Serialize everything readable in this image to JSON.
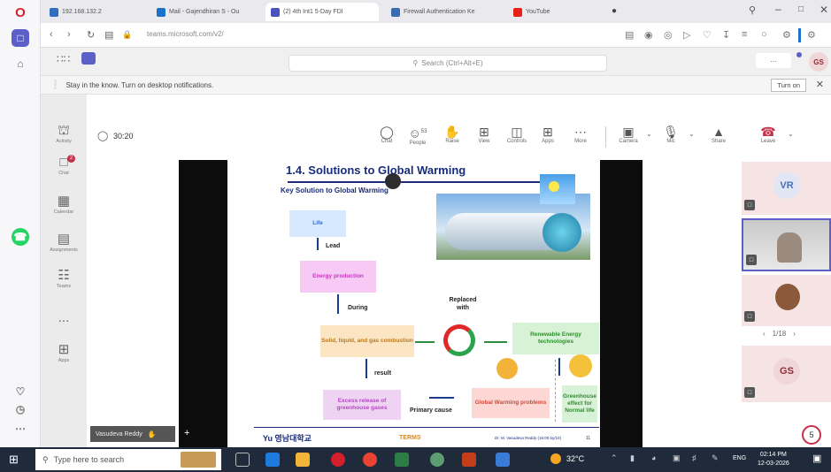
{
  "browser": {
    "tabs": [
      {
        "label": "192.168.132.2",
        "color": "#2f6fbf"
      },
      {
        "label": "Mail - Gajendhiran S - Ou",
        "color": "#1a73c9"
      },
      {
        "label": "(2) 4th Int1 5-Day FDI",
        "color": "#4b53bc"
      },
      {
        "label": "Firewall Authentication Ke",
        "color": "#3b6bb0"
      },
      {
        "label": "YouTube",
        "color": "#e62117"
      }
    ],
    "url": "teams.microsoft.com/v2/",
    "colors": {
      "opera_red": "#d4202b",
      "teams_purple": "#5b5fc7"
    }
  },
  "teams": {
    "search_placeholder": "Search (Ctrl+Alt+E)",
    "more_label": "...",
    "user_initials": "GS",
    "notification": {
      "text": "Stay in the know. Turn on desktop notifications.",
      "button": "Turn on"
    },
    "rail": [
      {
        "label": "Activity",
        "icon": "bell-icon"
      },
      {
        "label": "Chat",
        "icon": "chat-icon",
        "badge": "2"
      },
      {
        "label": "Calendar",
        "icon": "calendar-icon"
      },
      {
        "label": "Assignments",
        "icon": "assignments-icon"
      },
      {
        "label": "Teams",
        "icon": "teams-icon"
      },
      {
        "label": "...",
        "icon": "more-icon"
      },
      {
        "label": "Apps",
        "icon": "apps-icon"
      }
    ]
  },
  "meeting": {
    "timer": "30:20",
    "people_count": "53",
    "toolbar": [
      {
        "label": "Chat",
        "icon": "chat-icon"
      },
      {
        "label": "People",
        "icon": "people-icon"
      },
      {
        "label": "Raise",
        "icon": "raise-hand-icon"
      },
      {
        "label": "View",
        "icon": "view-icon"
      },
      {
        "label": "Controls",
        "icon": "controls-icon"
      },
      {
        "label": "Apps",
        "icon": "apps-icon"
      },
      {
        "label": "More",
        "icon": "more-icon"
      },
      {
        "label": "Camera",
        "icon": "camera-icon"
      },
      {
        "label": "Mic",
        "icon": "mic-icon"
      },
      {
        "label": "Share",
        "icon": "share-icon"
      },
      {
        "label": "Leave",
        "icon": "leave-icon"
      }
    ],
    "presenter": "Vasudeva Reddy",
    "participants": [
      {
        "initials": "VR",
        "color": "#4a6fb5"
      },
      {
        "initials": "",
        "type": "video"
      },
      {
        "initials": "",
        "type": "photo"
      },
      {
        "initials": "GS",
        "color": "#8a2e34"
      }
    ],
    "page_indicator": "1/18",
    "slide": {
      "title": "1.4. Solutions to Global Warming",
      "subtitle": "Key Solution to Global Warming",
      "boxes": {
        "life": "Life",
        "energy": "Energy production",
        "fuel": "Solid, liquid, and gas combustion",
        "excess": "Excess release of greenhouse gases",
        "problems": "Global Warming problems",
        "renewable": "Renewable Energy technologies",
        "greenhouse": "Greenhouse effect for Normal life"
      },
      "labels": {
        "lead": "Lead",
        "during": "During",
        "result": "result",
        "replaced": "Replaced with",
        "primary": "Primary cause"
      },
      "footer_logo": "Yu 영남대학교",
      "footer_brand": "TERMS",
      "footer_author": "Dr. M. Vasudeva Reddy (16:00 by/10)",
      "footer_page": "11"
    }
  },
  "taskbar": {
    "search_placeholder": "Type here to search",
    "temperature": "32°C",
    "language": "ENG",
    "time": "02:14 PM",
    "date": "12-03-2026",
    "notification_count": "5"
  }
}
